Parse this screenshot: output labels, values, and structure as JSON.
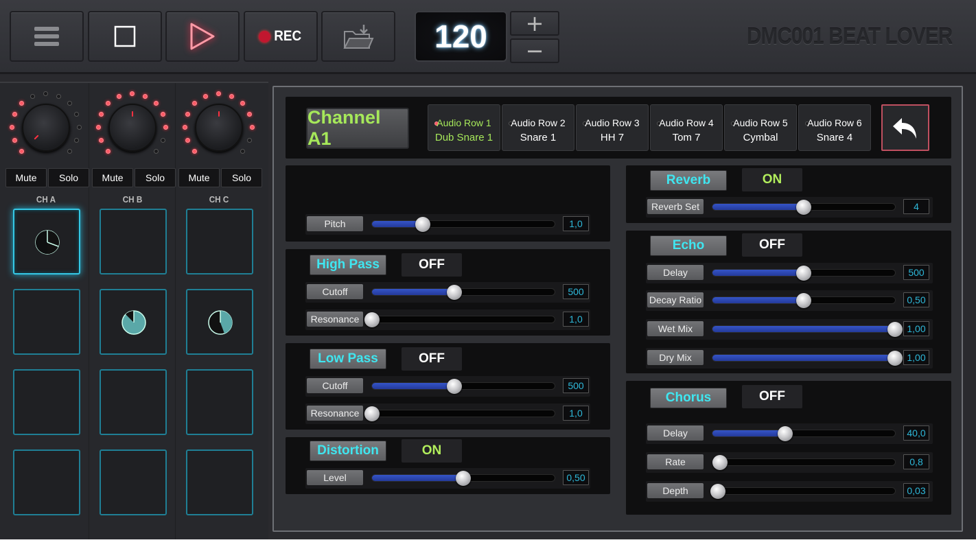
{
  "toolbar": {
    "menu_icon": "hamburger-menu-icon",
    "stop_icon": "stop-icon",
    "play_icon": "play-icon",
    "rec_label": "REC",
    "open_icon": "folder-open-icon",
    "bpm": "120",
    "plus_label": "+",
    "minus_label": "−",
    "brand": "DMC001 BEAT LOVER"
  },
  "channels": [
    {
      "label": "CH A",
      "mute": "Mute",
      "solo": "Solo"
    },
    {
      "label": "CH B",
      "mute": "Mute",
      "solo": "Solo"
    },
    {
      "label": "CH C",
      "mute": "Mute",
      "solo": "Solo"
    }
  ],
  "editor": {
    "channel_title": "Channel A1",
    "rows": [
      {
        "title": "Audio Row 1",
        "sample": "Dub Snare 1",
        "selected": true
      },
      {
        "title": "Audio Row 2",
        "sample": "Snare 1",
        "selected": false
      },
      {
        "title": "Audio Row 3",
        "sample": "HH 7",
        "selected": false
      },
      {
        "title": "Audio Row 4",
        "sample": "Tom 7",
        "selected": false
      },
      {
        "title": "Audio Row 5",
        "sample": "Cymbal",
        "selected": false
      },
      {
        "title": "Audio Row 6",
        "sample": "Snare 4",
        "selected": false
      }
    ],
    "back_icon": "undo-arrow-icon",
    "pitch": {
      "label": "Pitch",
      "value": "1,0",
      "level": 0.28
    },
    "high_pass": {
      "name": "High Pass",
      "state": "OFF",
      "cutoff": {
        "label": "Cutoff",
        "value": "500",
        "level": 0.45
      },
      "resonance": {
        "label": "Resonance",
        "value": "1,0",
        "level": 0.0
      }
    },
    "low_pass": {
      "name": "Low Pass",
      "state": "OFF",
      "cutoff": {
        "label": "Cutoff",
        "value": "500",
        "level": 0.45
      },
      "resonance": {
        "label": "Resonance",
        "value": "1,0",
        "level": 0.0
      }
    },
    "distortion": {
      "name": "Distortion",
      "state": "ON",
      "level": {
        "label": "Level",
        "value": "0,50",
        "level": 0.5
      }
    },
    "reverb": {
      "name": "Reverb",
      "state": "ON",
      "set": {
        "label": "Reverb Set",
        "value": "4",
        "level": 0.5
      }
    },
    "echo": {
      "name": "Echo",
      "state": "OFF",
      "delay": {
        "label": "Delay",
        "value": "500",
        "level": 0.5
      },
      "decay": {
        "label": "Decay Ratio",
        "value": "0,50",
        "level": 0.5
      },
      "wet": {
        "label": "Wet Mix",
        "value": "1,00",
        "level": 1.0
      },
      "dry": {
        "label": "Dry Mix",
        "value": "1,00",
        "level": 1.0
      }
    },
    "chorus": {
      "name": "Chorus",
      "state": "OFF",
      "delay": {
        "label": "Delay",
        "value": "40,0",
        "level": 0.4
      },
      "rate": {
        "label": "Rate",
        "value": "0,8",
        "level": 0.04
      },
      "depth": {
        "label": "Depth",
        "value": "0,03",
        "level": 0.03
      }
    }
  },
  "colors": {
    "accent_cyan": "#3fe6f0",
    "accent_green": "#a6e85a",
    "led_red": "#ff5a66"
  }
}
